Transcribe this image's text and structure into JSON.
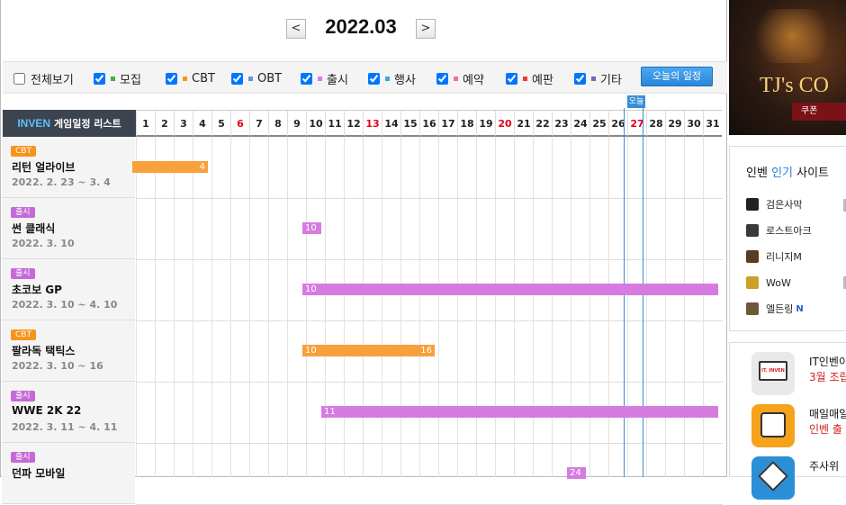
{
  "nav": {
    "prev": "<",
    "title": "2022.03",
    "next": ">"
  },
  "filters": [
    {
      "label": "전체보기",
      "checked": false,
      "color": ""
    },
    {
      "label": "모집",
      "checked": true,
      "color": "#3bb34a"
    },
    {
      "label": "CBT",
      "checked": true,
      "color": "#f7941d"
    },
    {
      "label": "OBT",
      "checked": true,
      "color": "#6a8fe0"
    },
    {
      "label": "출시",
      "checked": true,
      "color": "#d67be0"
    },
    {
      "label": "행사",
      "checked": true,
      "color": "#3aa8d8"
    },
    {
      "label": "예약",
      "checked": true,
      "color": "#f06ea9"
    },
    {
      "label": "예판",
      "checked": true,
      "color": "#ee3a3a"
    },
    {
      "label": "기타",
      "checked": true,
      "color": "#6b6bbf"
    }
  ],
  "today_button": "오늘의 일정",
  "list_header": {
    "brand": "INVEN",
    "label": "게임일정 리스트"
  },
  "days": [
    "1",
    "2",
    "3",
    "4",
    "5",
    "6",
    "7",
    "8",
    "9",
    "10",
    "11",
    "12",
    "13",
    "14",
    "15",
    "16",
    "17",
    "18",
    "19",
    "20",
    "21",
    "22",
    "23",
    "24",
    "25",
    "26",
    "27",
    "28",
    "29",
    "30",
    "31"
  ],
  "red_days": [
    6,
    13,
    20,
    27
  ],
  "today": {
    "label": "오늘",
    "day": 27
  },
  "events": [
    {
      "badge": "CBT",
      "badge_color": "#f7941d",
      "name": "리턴 얼라이브",
      "date": "2022. 2. 23 ~ 3. 4",
      "bar_color": "#f7a03c",
      "start": 1,
      "end": 4,
      "start_label": "",
      "end_label": "4"
    },
    {
      "badge": "출시",
      "badge_color": "#c46ad6",
      "name": "썬 클래식",
      "date": "2022. 3. 10",
      "bar_color": "#d67be0",
      "start": 10,
      "end": 10,
      "start_label": "10",
      "end_label": ""
    },
    {
      "badge": "출시",
      "badge_color": "#c46ad6",
      "name": "초코보 GP",
      "date": "2022. 3. 10 ~ 4. 10",
      "bar_color": "#d67be0",
      "start": 10,
      "end": 31,
      "start_label": "10",
      "end_label": ""
    },
    {
      "badge": "CBT",
      "badge_color": "#f7941d",
      "name": "팔라독 택틱스",
      "date": "2022. 3. 10 ~ 16",
      "bar_color": "#f7a03c",
      "start": 10,
      "end": 16,
      "start_label": "10",
      "end_label": "16"
    },
    {
      "badge": "출시",
      "badge_color": "#c46ad6",
      "name": "WWE 2K 22",
      "date": "2022. 3. 11 ~ 4. 11",
      "bar_color": "#d67be0",
      "start": 11,
      "end": 31,
      "start_label": "11",
      "end_label": ""
    },
    {
      "badge": "출시",
      "badge_color": "#c46ad6",
      "name": "던파 모바일",
      "date": "",
      "bar_color": "#d67be0",
      "start": 24,
      "end": 24,
      "start_label": "24",
      "end_label": ""
    }
  ],
  "ad": {
    "title": "TJ's CO",
    "coupon": "쿠폰"
  },
  "popular": {
    "title_pre": "인벤 ",
    "title_hl": "인기",
    "title_post": " 사이트",
    "sites": [
      {
        "name": "검은사막",
        "new": "",
        "icon_color": "#222222"
      },
      {
        "name": "로스트아크",
        "new": "",
        "icon_color": "#3a3a3a"
      },
      {
        "name": "리니지M",
        "new": "",
        "icon_color": "#5a3b20"
      },
      {
        "name": "WoW",
        "new": "",
        "icon_color": "#c9a227"
      },
      {
        "name": "엘든링",
        "new": "N",
        "icon_color": "#6b5a3a"
      }
    ]
  },
  "apps": [
    {
      "title": "IT인벤이",
      "sub": "3월 조립",
      "icon_bg": "#e9e9e9",
      "icon_text": "IT. INVEN"
    },
    {
      "title": "매일매일",
      "sub": "인벤 출",
      "icon_bg": "#f7a21b",
      "icon_text": ""
    },
    {
      "title": "주사위",
      "sub": "",
      "icon_bg": "#2b8fd8",
      "icon_text": ""
    }
  ]
}
